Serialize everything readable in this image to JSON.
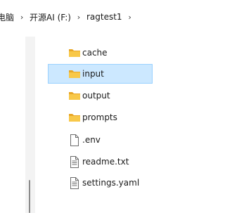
{
  "breadcrumb": {
    "items": [
      "电脑",
      "开源AI (F:)",
      "ragtest1"
    ],
    "separator": "›"
  },
  "files": [
    {
      "label": "cache",
      "icon": "folder-icon",
      "selected": false
    },
    {
      "label": "input",
      "icon": "folder-icon",
      "selected": true
    },
    {
      "label": "output",
      "icon": "folder-icon",
      "selected": false
    },
    {
      "label": "prompts",
      "icon": "folder-icon",
      "selected": false
    },
    {
      "label": ".env",
      "icon": "blank-file-icon",
      "selected": false
    },
    {
      "label": "readme.txt",
      "icon": "text-file-icon",
      "selected": false
    },
    {
      "label": "settings.yaml",
      "icon": "text-file-icon",
      "selected": false
    }
  ],
  "colors": {
    "selection_bg": "#cce8ff",
    "selection_border": "#99d1ff",
    "folder": "#f8c849"
  }
}
